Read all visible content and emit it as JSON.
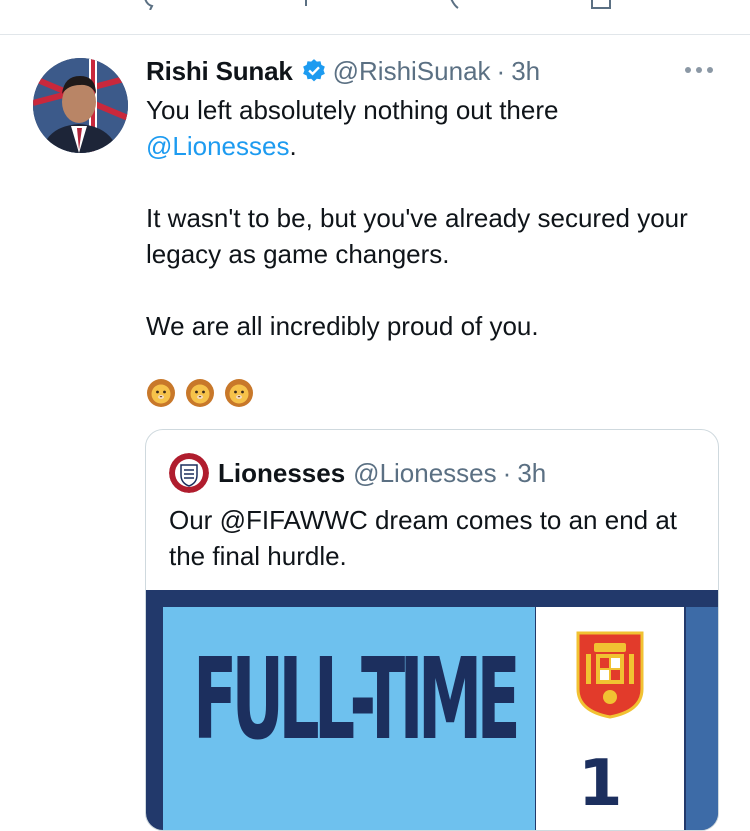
{
  "top_actions": {
    "icons": [
      "reply-icon",
      "retweet-icon",
      "like-icon",
      "share-icon"
    ]
  },
  "tweet": {
    "author_name": "Rishi Sunak",
    "verified": true,
    "handle": "@RishiSunak",
    "separator": "·",
    "time": "3h",
    "text": {
      "line1": "You left absolutely nothing out there",
      "mention": "@Lionesses",
      "mention_suffix": ".",
      "para2": "It wasn't to be, but you've already secured your legacy as game changers.",
      "para3": "We are all incredibly proud of you."
    },
    "emojis": [
      "lion-face-icon",
      "lion-face-icon",
      "lion-face-icon"
    ]
  },
  "quote": {
    "author_name": "Lionesses",
    "handle": "@Lionesses",
    "separator": "·",
    "time": "3h",
    "text": "Our @FIFAWWC dream comes to an end at the final hurdle.",
    "media": {
      "headline": "FULL-TIME",
      "score": "1"
    }
  },
  "colors": {
    "link": "#1d9bf0",
    "secondary_text": "#5b7083",
    "verified": "#1d9bf0",
    "media_blue": "#6ec1ee",
    "media_navy": "#1c2f5e"
  }
}
